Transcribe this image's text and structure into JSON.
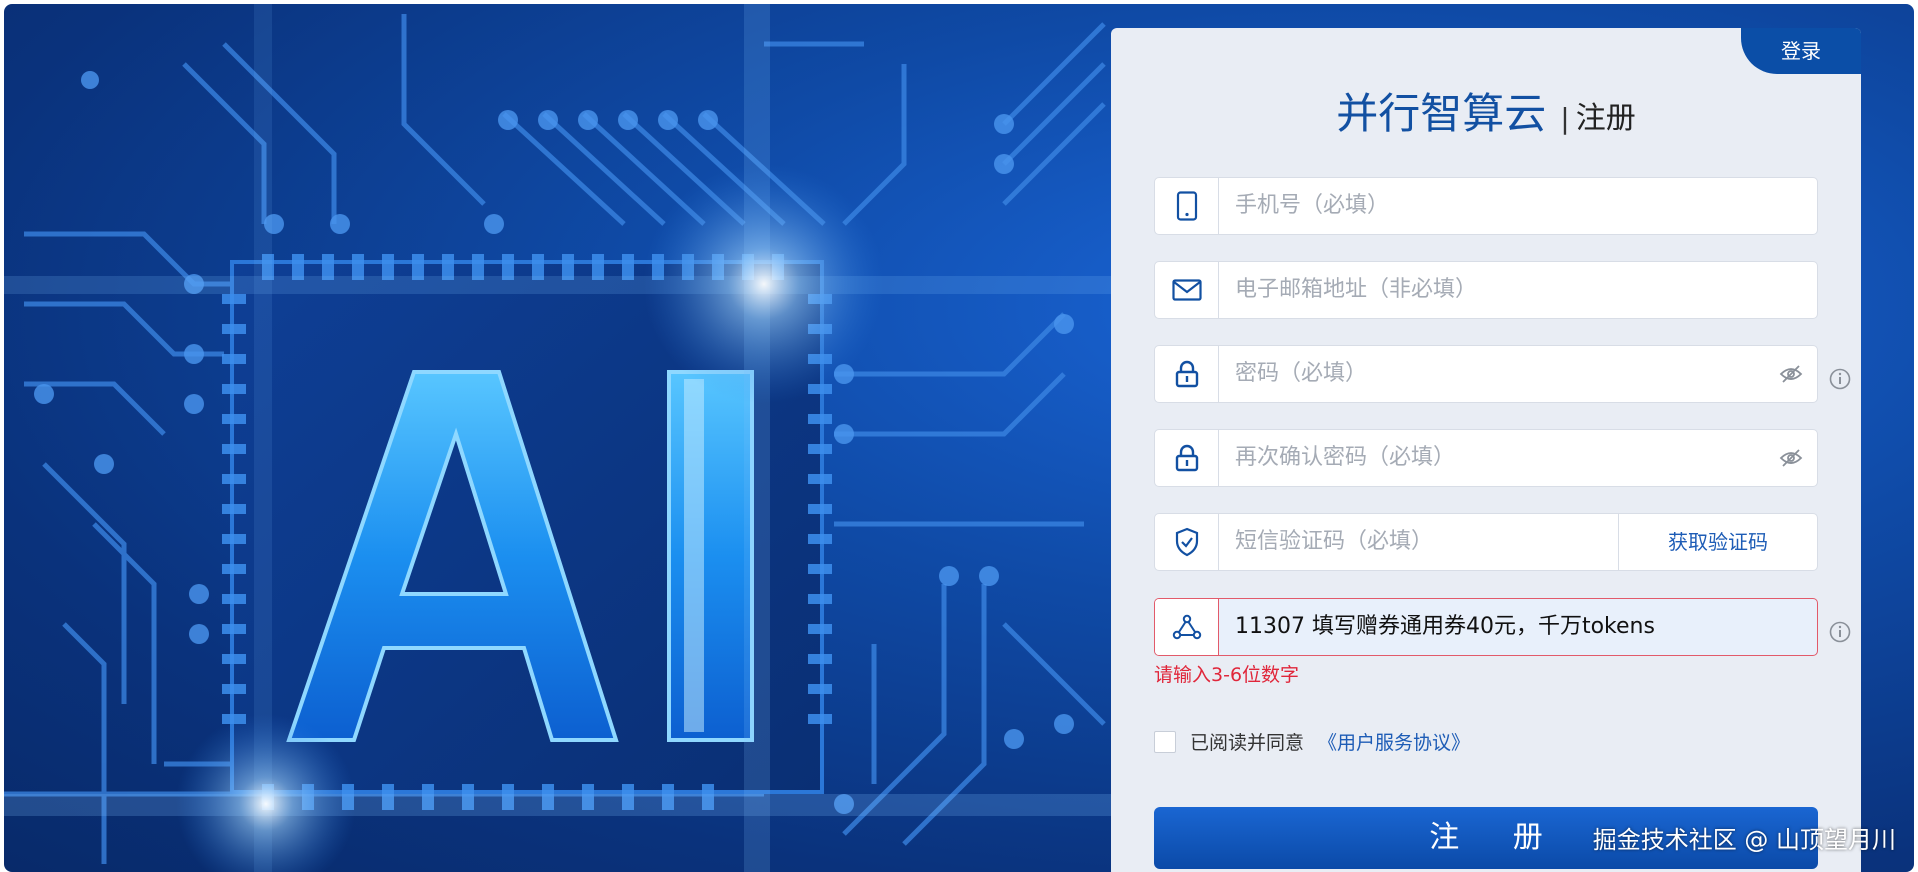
{
  "header": {
    "login_tab": "登录",
    "brand": "并行智算云",
    "separator": "|",
    "subtitle": "注册"
  },
  "form": {
    "phone": {
      "placeholder": "手机号（必填）",
      "icon": "phone-icon"
    },
    "email": {
      "placeholder": "电子邮箱地址（非必填）",
      "icon": "mail-icon"
    },
    "password": {
      "placeholder": "密码（必填）",
      "icon": "lock-icon"
    },
    "confirm_password": {
      "placeholder": "再次确认密码（必填）",
      "icon": "lock-icon"
    },
    "sms": {
      "placeholder": "短信验证码（必填）",
      "icon": "shield-check-icon",
      "button": "获取验证码"
    },
    "invite": {
      "value": "11307 填写赠券通用券40元，千万tokens",
      "icon": "network-icon",
      "error": "请输入3-6位数字"
    },
    "agree": {
      "text": "已阅读并同意",
      "link": "《用户服务协议》",
      "checked": false
    },
    "submit": "注 册"
  },
  "hero": {
    "letters": "AI"
  },
  "watermark": "掘金技术社区 @ 山顶望月川",
  "colors": {
    "brand": "#1250a2",
    "error": "#e0263a",
    "accent": "#0b4ea7"
  }
}
